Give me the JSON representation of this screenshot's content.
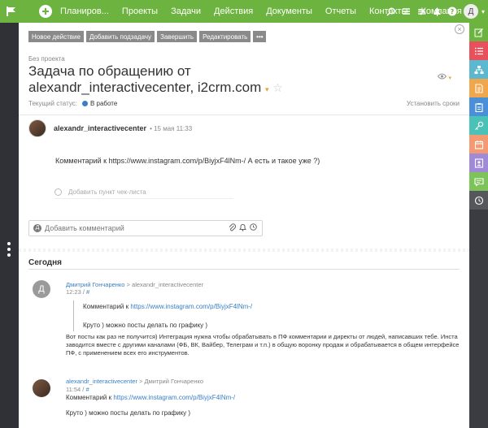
{
  "topbar": {
    "nav": [
      "Планиров...",
      "Проекты",
      "Задачи",
      "Действия",
      "Документы",
      "Отчеты",
      "Контакты",
      "Компания"
    ],
    "avatar_letter": "Д"
  },
  "toolbar": {
    "buttons": [
      "Новое действие",
      "Добавить подзадачу",
      "Завершить",
      "Редактировать"
    ],
    "more": "•••"
  },
  "task": {
    "project": "Без проекта",
    "title": "Задача по обращению от alexandr_interactivecenter, i2crm.com",
    "status_label": "Текущий статус:",
    "status_value": "В работе",
    "set_deadline": "Установить сроки",
    "author": "alexandr_interactivecenter",
    "date": "• 15 мая 11:33",
    "body": "Комментарий к https://www.instagram.com/p/BiyjxF4lNm-/ А есть и такое уже ?)",
    "checklist_placeholder": "Добавить пункт чек-листа"
  },
  "comment_box": {
    "placeholder": "Добавить комментарий"
  },
  "today": {
    "heading": "Сегодня"
  },
  "comments": [
    {
      "avatar": "Д",
      "author": "Дмитрий Гончаренко",
      "recipient": "> alexandr_interactivecenter",
      "time": "12:23",
      "hash": "#",
      "quote_prefix": "Комментарий к",
      "quote_link": "https://www.instagram.com/p/BiyjxF4lNm-/",
      "quote_text": "Круто ) можно посты делать по графику )",
      "text": "Вот посты как раз не получится) Интеграция нужна чтобы обрабатывать в ПФ комментарии и директы от людей, написавших тебе. Инста заводится вместе с другими каналами (ФБ, ВК, Вайбер, Телеграм и т.п.) в общую воронку продаж и обрабатывается в общем интерфейсе ПФ, с применением всех его инструментов."
    },
    {
      "author": "alexandr_interactivecenter",
      "recipient": "> Дмитрий Гончаренко",
      "time": "11:54",
      "hash": "#",
      "link_prefix": "Комментарий к",
      "link": "https://www.instagram.com/p/BiyjxF4lNm-/",
      "text": "Круто ) можно посты делать по графику )"
    }
  ],
  "colors": {
    "topbar": "#6db33f",
    "link": "#3a7fc6",
    "accent": "#e8a23a",
    "status_dot": "#3a7fc6"
  },
  "right_panel_icons": [
    {
      "name": "edit-icon",
      "color": "#6db33f"
    },
    {
      "name": "list-icon",
      "color": "#e8505b"
    },
    {
      "name": "org-chart-icon",
      "color": "#5bb8d0"
    },
    {
      "name": "document-icon",
      "color": "#f0a64a"
    },
    {
      "name": "clipboard-icon",
      "color": "#4a90d9"
    },
    {
      "name": "key-icon",
      "color": "#4bc2b8"
    },
    {
      "name": "calendar-icon",
      "color": "#f39a72"
    },
    {
      "name": "contacts-icon",
      "color": "#a08ad8"
    },
    {
      "name": "chat-icon",
      "color": "#7cc35a"
    },
    {
      "name": "history-icon",
      "color": "#55575d"
    }
  ]
}
